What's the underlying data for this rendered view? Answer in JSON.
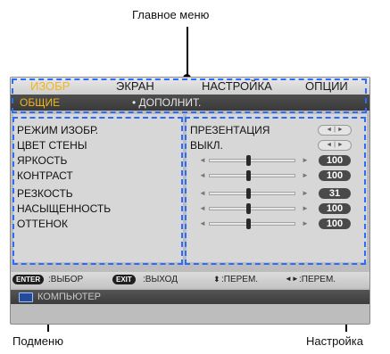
{
  "annotations": {
    "main_menu": "Главное меню",
    "submenu": "Подменю",
    "setting": "Настройка"
  },
  "tabs": [
    "ИЗОБР",
    "ЭКРАН",
    "НАСТРОЙКА",
    "ОПЦИИ"
  ],
  "subtabs": {
    "active": "ОБЩИЕ",
    "other": "• ДОПОЛНИТ."
  },
  "menu_items": [
    "РЕЖИМ ИЗОБР.",
    "ЦВЕТ СТЕНЫ",
    "ЯРКОСТЬ",
    "КОНТРАСТ",
    "РЕЗКОСТЬ",
    "НАСЫЩЕННОСТЬ",
    "ОТТЕНОК"
  ],
  "settings": {
    "picture_mode": "ПРЕЗЕНТАЦИЯ",
    "wall_color": "ВЫКЛ.",
    "brightness": "100",
    "contrast": "100",
    "sharpness": "31",
    "saturation": "100",
    "tint": "100"
  },
  "footer": {
    "enter_key": "ENTER",
    "enter_label": ":ВЫБОР",
    "exit_key": "EXIT",
    "exit_label": ":ВЫХОД",
    "updown_label": ":ПЕРЕМ.",
    "leftright_label": ":ПЕРЕМ."
  },
  "source": {
    "label": "КОМПЬЮТЕР",
    "icon": "monitor-icon"
  },
  "colors": {
    "active_tab": "#f2b51b",
    "dashed_outline": "#2a6cff",
    "panel": "#d7d7d7"
  }
}
